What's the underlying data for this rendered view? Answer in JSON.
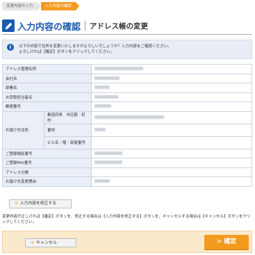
{
  "steps": [
    {
      "label": "変更内容の入力",
      "active": false
    },
    {
      "label": "入力内容の確認",
      "active": true
    }
  ],
  "heading": {
    "title": "入力内容の確認",
    "subtitle": "アドレス帳の変更",
    "icon": "pencil-icon"
  },
  "notice": {
    "icon": "info-icon",
    "line1": "以下の内容で住所を変更いたしますがよろしいでしょうか？入力内容をご確認ください。",
    "line2": "よろしければ【確定】ボタンをクリックしてください。"
  },
  "table": {
    "rows": [
      {
        "label": "アドレス管理名称",
        "value_width": 70
      },
      {
        "label": "会社名",
        "value_width": 36
      },
      {
        "label": "部署名",
        "value_width": 22
      },
      {
        "label": "お受取担当者名",
        "value_width": 34
      },
      {
        "label": "郵便番号",
        "value_width": 24
      }
    ],
    "delivery": {
      "label": "お届け先住所",
      "subrows": [
        {
          "label": "都道府県　市区郡　町村",
          "value_width": 100
        },
        {
          "label": "番地",
          "value_width": 16
        },
        {
          "label": "ビル名・階・部屋番号",
          "value_width": 0
        }
      ]
    },
    "rows2": [
      {
        "label": "ご登録電話番号",
        "value_width": 40
      },
      {
        "label": "ご登録FAX番号",
        "value_width": 40
      },
      {
        "label": "アドレス分類",
        "value_width": 0
      },
      {
        "label": "お届け先変更理由",
        "value_width": 22
      }
    ]
  },
  "fix_button": {
    "label": "入力内容を修正する",
    "icon": "chevron-left-icon"
  },
  "foot_note": "変更内容が正しければ【確定】ボタンを、修正する場合は【入力内容を修正する】ボタンを、キャンセルする場合は【キャンセル】ボタンをクリックしてください。",
  "cancel_button": {
    "label": "キャンセル",
    "icon": "chevron-left-icon"
  },
  "confirm_button": {
    "label": "確定",
    "icon": "chevron-right-icon"
  },
  "colors": {
    "accent": "#f39a1f",
    "brand": "#1a59b0",
    "label_bg": "#e9eef7",
    "notice_bg": "#e9edf6",
    "bottom_bg": "#fbe9cc"
  }
}
